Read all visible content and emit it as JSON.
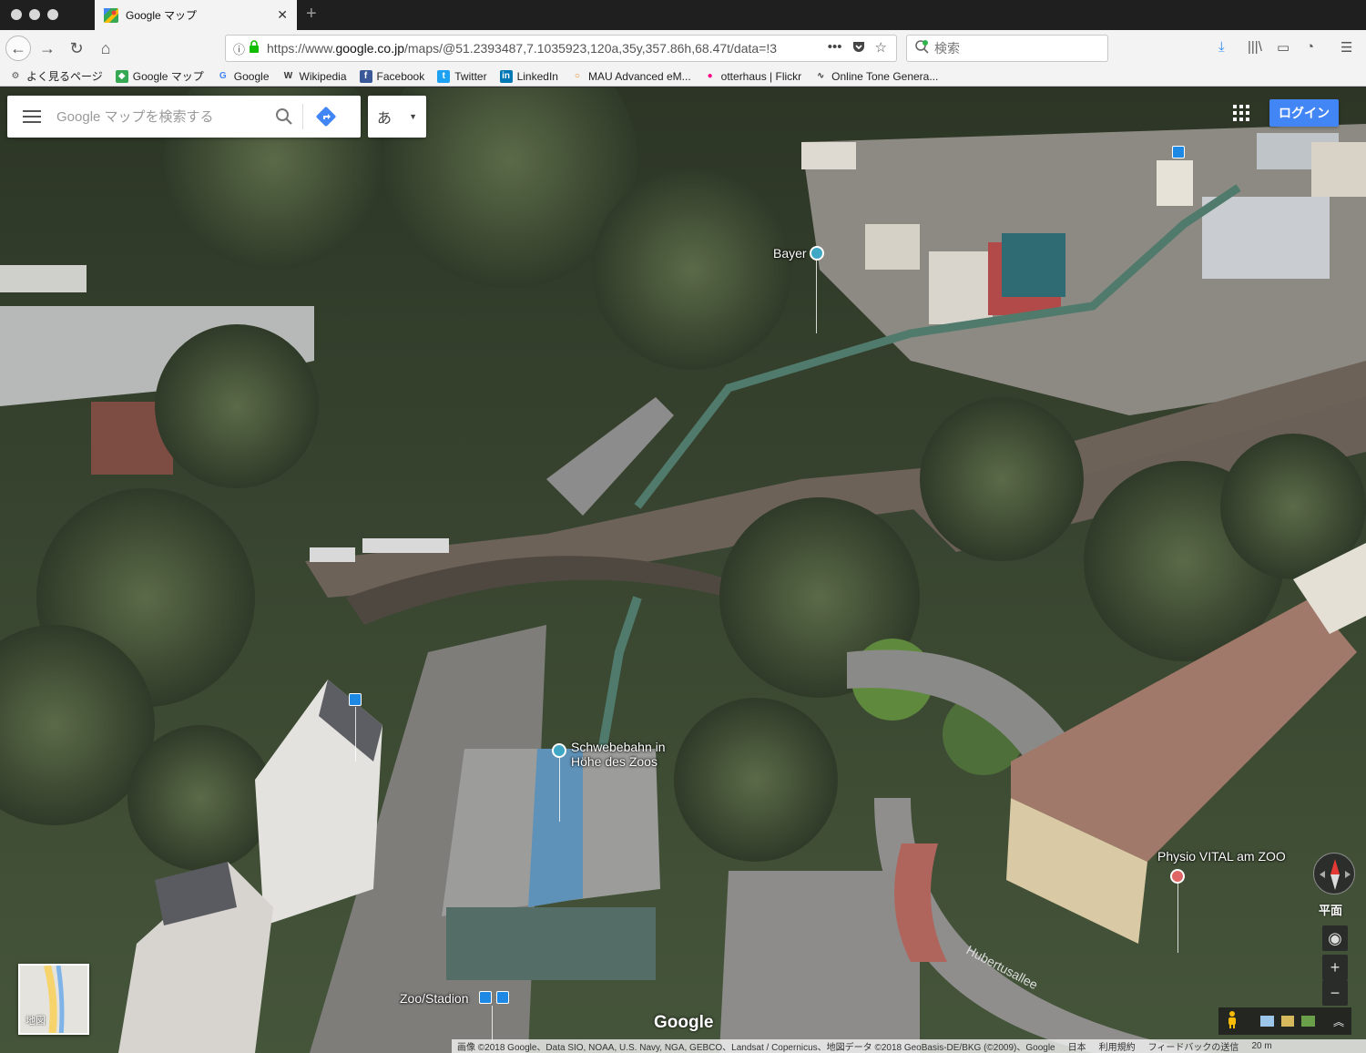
{
  "browser": {
    "tab_title": "Google マップ",
    "url_prefix": "https://www.",
    "url_domain": "google.co.jp",
    "url_path": "/maps/@51.2393487,7.1035923,120a,35y,357.86h,68.47t/data=!3",
    "search_placeholder": "検索",
    "bookmarks": [
      {
        "label": "よく見るページ",
        "icon": "gear-icon",
        "color": "#555555"
      },
      {
        "label": "Google マップ",
        "icon": "google-maps-icon",
        "color": "#34a853"
      },
      {
        "label": "Google",
        "icon": "google-icon",
        "color": "#4285f4"
      },
      {
        "label": "Wikipedia",
        "icon": "wikipedia-icon",
        "color": "#333333"
      },
      {
        "label": "Facebook",
        "icon": "facebook-icon",
        "color": "#3b5998"
      },
      {
        "label": "Twitter",
        "icon": "twitter-icon",
        "color": "#1da1f2"
      },
      {
        "label": "LinkedIn",
        "icon": "linkedin-icon",
        "color": "#0077b5"
      },
      {
        "label": "MAU Advanced eM...",
        "icon": "ring-icon",
        "color": "#e8811c"
      },
      {
        "label": "otterhaus | Flickr",
        "icon": "flickr-icon",
        "color": "#ff0084"
      },
      {
        "label": "Online Tone Genera...",
        "icon": "wave-icon",
        "color": "#333333"
      }
    ]
  },
  "maps": {
    "search_placeholder": "Google マップを検索する",
    "ime_label": "あ",
    "login_label": "ログイン",
    "places": {
      "bayer": "Bayer",
      "schwebebahn": "Schwebebahn in\nHöhe des Zoos",
      "zoo_stadion": "Zoo/Stadion",
      "physio": "Physio VITAL am ZOO"
    },
    "street_label": "Hubertusallee",
    "minimap_label": "地図",
    "google_logo": "Google",
    "view_mode": "平面",
    "zoom_in": "+",
    "zoom_out": "−",
    "attribution": "画像 ©2018 Google、Data SIO, NOAA, U.S. Navy, NGA, GEBCO、Landsat / Copernicus、地図データ ©2018 GeoBasis-DE/BKG (©2009)、Google",
    "country": "日本",
    "terms": "利用規約",
    "feedback": "フィードバックの送信",
    "scale": "20 m"
  },
  "colors": {
    "accent": "#4285f4",
    "forest": "#3d4a34",
    "pin": "#40a8c4",
    "physio_pin": "#e06666"
  }
}
